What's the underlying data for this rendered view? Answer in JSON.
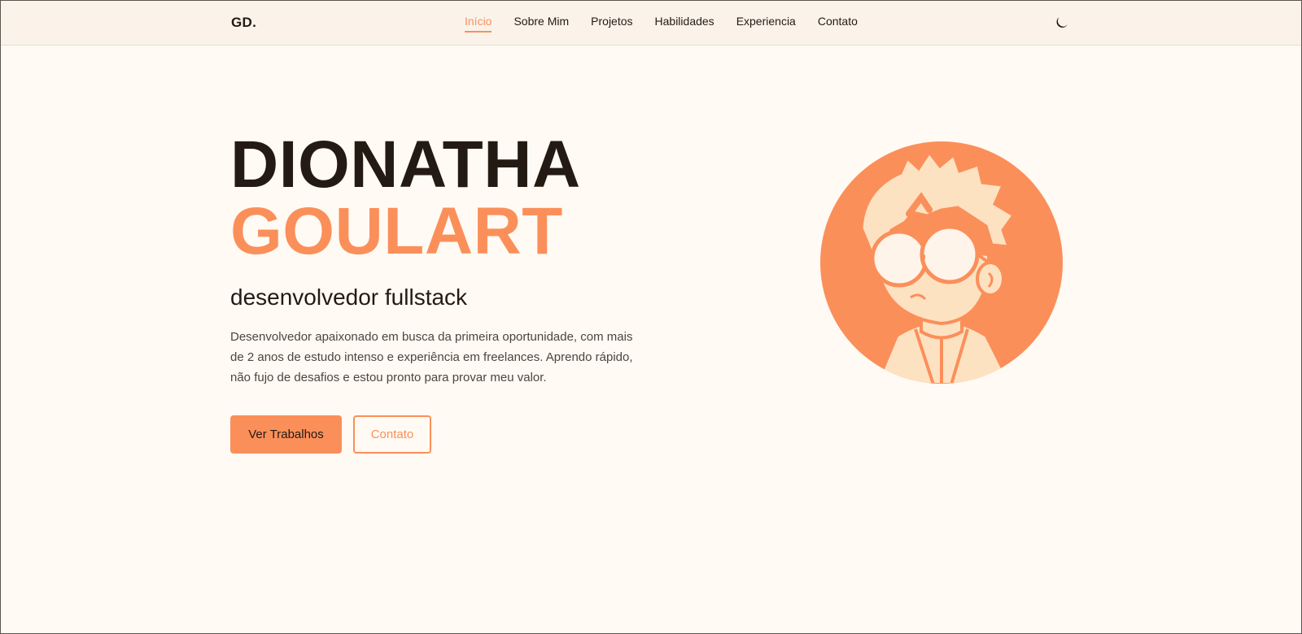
{
  "header": {
    "logo": "GD.",
    "nav": [
      {
        "label": "Início",
        "active": true
      },
      {
        "label": "Sobre Mim",
        "active": false
      },
      {
        "label": "Projetos",
        "active": false
      },
      {
        "label": "Habilidades",
        "active": false
      },
      {
        "label": "Experiencia",
        "active": false
      },
      {
        "label": "Contato",
        "active": false
      }
    ],
    "theme_toggle_icon": "moon-icon"
  },
  "hero": {
    "first_name": "DIONATHA",
    "last_name": "GOULART",
    "role": "desenvolvedor fullstack",
    "bio": "Desenvolvedor apaixonado em busca da primeira oportunidade, com mais de 2 anos de estudo intenso e experiência em freelances. Aprendo rápido, não fujo de desafios e estou pronto para provar meu valor.",
    "primary_button": "Ver Trabalhos",
    "secondary_button": "Contato",
    "avatar_icon": "avatar-illustration"
  },
  "colors": {
    "accent": "#fb8f5a",
    "background": "#fffaf3",
    "header_bg": "#fbf3ea",
    "text": "#231a14"
  }
}
